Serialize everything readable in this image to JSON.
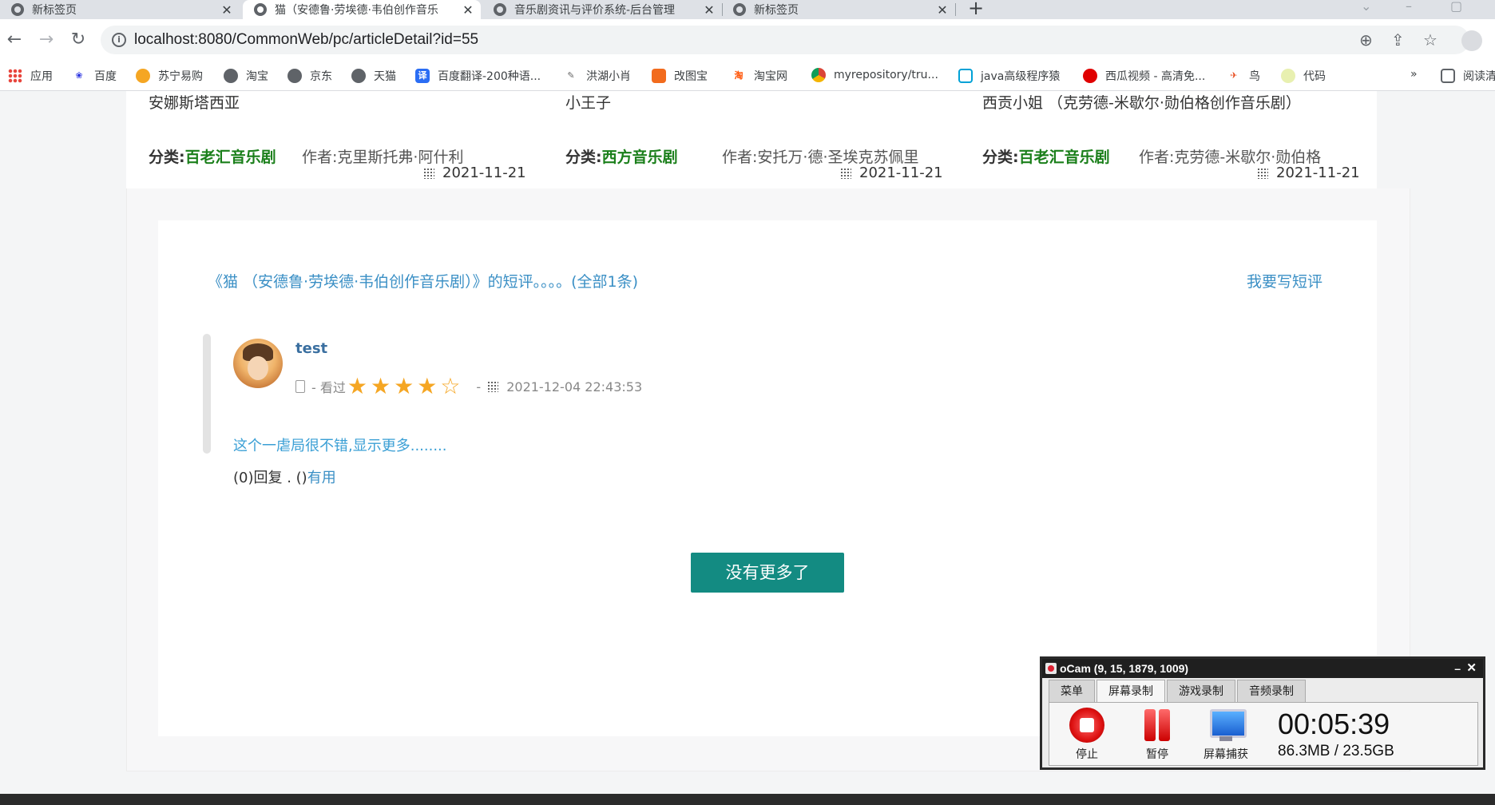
{
  "browser": {
    "tabs": [
      {
        "title": "新标签页",
        "active": false
      },
      {
        "title": "猫（安德鲁·劳埃德·韦伯创作音乐",
        "active": true
      },
      {
        "title": "音乐剧资讯与评价系统-后台管理",
        "active": false
      },
      {
        "title": "新标签页",
        "active": false
      }
    ],
    "url": "localhost:8080/CommonWeb/pc/articleDetail?id=55",
    "bookmarks": [
      {
        "label": "应用",
        "color": "#e8453c"
      },
      {
        "label": "百度",
        "color": "#2932e1"
      },
      {
        "label": "苏宁易购",
        "color": "#f5a623"
      },
      {
        "label": "淘宝",
        "color": "#5f6368"
      },
      {
        "label": "京东",
        "color": "#5f6368"
      },
      {
        "label": "天猫",
        "color": "#5f6368"
      },
      {
        "label": "百度翻译-200种语...",
        "color": "#2a6df4"
      },
      {
        "label": "洪湖小肖",
        "color": "#888888"
      },
      {
        "label": "改图宝",
        "color": "#f26b1d"
      },
      {
        "label": "淘宝网",
        "color": "#ff5000"
      },
      {
        "label": "myrepository/tru...",
        "color": "#e34c26"
      },
      {
        "label": "java高级程序猿",
        "color": "#00a1d6"
      },
      {
        "label": "西瓜视频 - 高清免...",
        "color": "#e00000"
      },
      {
        "label": "鸟",
        "color": "#e84a1c"
      },
      {
        "label": "代码",
        "color": "#c8d86a"
      }
    ],
    "bookmarks_overflow": "»",
    "reading_list": "阅读清"
  },
  "cards": [
    {
      "title": "安娜斯塔西亚",
      "category_label": "分类:",
      "category": "百老汇音乐剧",
      "author": "作者:克里斯托弗·阿什利",
      "date": "2021-11-21"
    },
    {
      "title": "小王子",
      "category_label": "分类:",
      "category": "西方音乐剧",
      "author": "作者:安托万·德·圣埃克苏佩里",
      "date": "2021-11-21"
    },
    {
      "title": "西贡小姐 （克劳德-米歇尔·勋伯格创作音乐剧）",
      "category_label": "分类:",
      "category": "百老汇音乐剧",
      "author": "作者:克劳德-米歇尔·勋伯格",
      "date": "2021-11-21"
    }
  ],
  "reviews": {
    "heading": "《猫 （安德鲁·劳埃德·韦伯创作音乐剧）》的短评。。。。(全部1条)",
    "write_link": "我要写短评",
    "items": [
      {
        "user": "test",
        "status_prefix": "- 看过",
        "rating": 4,
        "rating_max": 5,
        "date_prefix": "-",
        "datetime": "2021-12-04 22:43:53",
        "text": "这个一虐局很不错,显示更多........",
        "reply_text": "(0)回复 . ()",
        "useful_text": "有用"
      }
    ],
    "no_more_button": "没有更多了"
  },
  "ocam": {
    "title": "oCam (9, 15, 1879, 1009)",
    "tabs": [
      "菜单",
      "屏幕录制",
      "游戏录制",
      "音频录制"
    ],
    "active_tab": "屏幕录制",
    "buttons": {
      "stop": "停止",
      "pause": "暂停",
      "capture": "屏幕捕获"
    },
    "time": "00:05:39",
    "size": "86.3MB / 23.5GB"
  }
}
